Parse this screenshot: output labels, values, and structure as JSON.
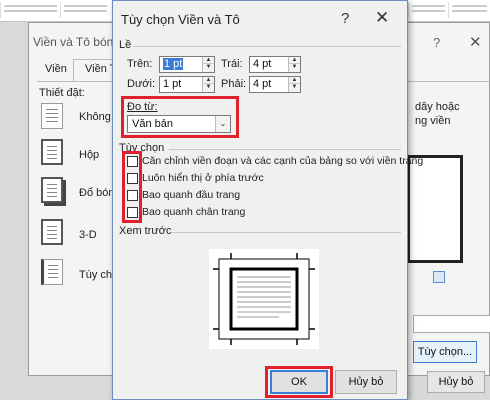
{
  "background_dialog": {
    "title": "Viền và Tô bóng",
    "help_glyph": "?",
    "close_glyph": "✕",
    "tabs": [
      "Viền",
      "Viền Tr"
    ],
    "setting_label": "Thiết đặt:",
    "settings": [
      "Không c",
      "Hộp",
      "Đổ bóng",
      "3-D",
      "Tùy chỉn"
    ],
    "right_text": [
      "dây hoặc",
      "ng viền"
    ],
    "options_button": "Tùy chọn...",
    "cancel_button": "Hủy bỏ"
  },
  "dialog": {
    "title": "Tùy chọn Viền và Tô",
    "help_glyph": "?",
    "close_glyph": "✕",
    "margin_group": "Lề",
    "margins": {
      "top": {
        "label": "Trên:",
        "value": "1 pt"
      },
      "left": {
        "label": "Trái:",
        "value": "4 pt"
      },
      "bottom": {
        "label": "Dưới:",
        "value": "1 pt"
      },
      "right": {
        "label": "Phải:",
        "value": "4 pt"
      }
    },
    "measure_from_label": "Đo từ:",
    "measure_from_value": "Văn bản",
    "options_group": "Tùy chọn",
    "options": [
      {
        "label": "Căn chỉnh viền đoạn và các cạnh của bảng so với viền trang",
        "checked": false
      },
      {
        "label": "Luôn hiển thị ở phía trước",
        "checked": false
      },
      {
        "label": "Bao quanh đầu trang",
        "checked": false
      },
      {
        "label": "Bao quanh chân trang",
        "checked": false
      }
    ],
    "preview_label": "Xem trước",
    "ok_button": "OK",
    "cancel_button": "Hủy bỏ",
    "spin_up_glyph": "▲",
    "spin_down_glyph": "▼",
    "dropdown_glyph": "⌄"
  },
  "colors": {
    "highlight": "#e0202a",
    "selection": "#3a7bd5",
    "default_button_border": "#3a7fd5"
  }
}
